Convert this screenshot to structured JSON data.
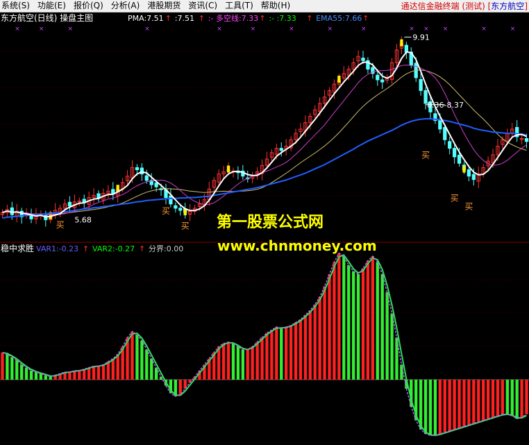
{
  "menu": {
    "items": [
      "系统(S)",
      "功能(E)",
      "报价(Q)",
      "分析(A)",
      "港股期货",
      "资讯(C)",
      "工具(T)",
      "帮助(H)"
    ],
    "title_prefix": "通达信金融终端 (测试) [",
    "title_stock": "东方航空",
    "title_suffix": "]"
  },
  "main_pane": {
    "title": "东方航空(日线) 操盘主图",
    "indicators": [
      {
        "label": "PMA:7.51",
        "color": "#ffffff",
        "arrow": "↑"
      },
      {
        "label": ":7.51",
        "color": "#ffffff",
        "arrow": "↑"
      },
      {
        "label": ":- 多空线:7.33",
        "color": "#ff44ff",
        "arrow": "↑"
      },
      {
        "label": ":- :7.33",
        "color": "#00ff00",
        "arrow": "↑"
      },
      {
        "label": "EMA55:7.66",
        "color": "#4a8cff",
        "arrow": "↑"
      }
    ],
    "annotations": {
      "high_label": "9.91",
      "range_label": "8.36-8.37",
      "low_label": "5.68",
      "buy_label": "买"
    }
  },
  "sub_pane": {
    "title": "稳中求胜",
    "indicators": [
      {
        "label": "VAR1:-0.23",
        "color": "#6060ff",
        "arrow": "↑"
      },
      {
        "label": "VAR2:-0.27",
        "color": "#00ff00",
        "arrow": "↑"
      },
      {
        "label": "分界:0.00",
        "color": "#cccccc",
        "arrow": ""
      }
    ]
  },
  "watermark": {
    "line1": "第一股票公式网",
    "line2": "www.chnmoney.com"
  },
  "colors": {
    "up": "#ff3232",
    "down": "#54ffff",
    "bar_red": "#ff2020",
    "bar_green": "#33ee33",
    "ma_white": "#ffffff",
    "ma_magenta": "#d040d0",
    "ma_yellow": "#d0c070",
    "ema_blue": "#2060ff",
    "var1": "#c060ff",
    "var2": "#30dd60",
    "divider": "#800000"
  },
  "chart_data": {
    "type": "candlestick",
    "price_range": [
      5.3,
      10.2
    ],
    "osc_range": [
      -0.42,
      0.88
    ],
    "close": [
      5.85,
      5.92,
      5.8,
      5.88,
      5.75,
      5.84,
      5.7,
      5.78,
      5.82,
      5.68,
      5.76,
      5.9,
      5.95,
      6.05,
      6.0,
      6.1,
      6.12,
      6.08,
      6.2,
      6.25,
      6.18,
      6.3,
      6.35,
      6.28,
      6.4,
      6.55,
      6.7,
      6.9,
      6.85,
      6.75,
      6.6,
      6.5,
      6.45,
      6.38,
      6.2,
      6.05,
      5.95,
      5.9,
      5.85,
      5.88,
      5.95,
      6.05,
      6.15,
      6.4,
      6.6,
      6.75,
      6.8,
      6.85,
      6.82,
      6.78,
      6.7,
      6.65,
      6.72,
      6.8,
      6.95,
      7.1,
      7.25,
      7.35,
      7.3,
      7.4,
      7.55,
      7.7,
      7.8,
      7.95,
      8.1,
      8.25,
      8.4,
      8.55,
      8.7,
      8.85,
      8.95,
      9.1,
      9.2,
      9.35,
      9.5,
      9.4,
      9.2,
      9.1,
      8.95,
      8.9,
      9.0,
      9.35,
      9.65,
      9.8,
      9.6,
      9.3,
      9.0,
      8.7,
      8.4,
      8.2,
      8.0,
      7.8,
      7.55,
      7.35,
      7.15,
      7.0,
      6.85,
      6.7,
      6.62,
      6.75,
      6.9,
      7.05,
      7.2,
      7.4,
      7.55,
      7.7,
      7.8,
      7.62,
      7.58,
      7.51
    ],
    "ema55": [
      5.72,
      5.74,
      5.75,
      5.76,
      5.77,
      5.78,
      5.79,
      5.8,
      5.81,
      5.82,
      5.83,
      5.84,
      5.85,
      5.87,
      5.88,
      5.9,
      5.91,
      5.93,
      5.94,
      5.96,
      5.97,
      5.99,
      6.0,
      6.02,
      6.03,
      6.05,
      6.06,
      6.08,
      6.1,
      6.11,
      6.13,
      6.14,
      6.15,
      6.16,
      6.17,
      6.18,
      6.18,
      6.19,
      6.19,
      6.2,
      6.2,
      6.21,
      6.22,
      6.23,
      6.25,
      6.27,
      6.29,
      6.31,
      6.33,
      6.35,
      6.37,
      6.39,
      6.41,
      6.43,
      6.46,
      6.49,
      6.52,
      6.55,
      6.58,
      6.61,
      6.65,
      6.69,
      6.73,
      6.77,
      6.82,
      6.87,
      6.92,
      6.97,
      7.03,
      7.09,
      7.15,
      7.21,
      7.27,
      7.33,
      7.4,
      7.46,
      7.52,
      7.57,
      7.62,
      7.67,
      7.72,
      7.77,
      7.83,
      7.89,
      7.94,
      7.98,
      8.01,
      8.03,
      8.04,
      8.04,
      8.03,
      8.02,
      8.0,
      7.98,
      7.95,
      7.92,
      7.89,
      7.86,
      7.82,
      7.79,
      7.77,
      7.75,
      7.73,
      7.72,
      7.71,
      7.7,
      7.7,
      7.69,
      7.68,
      7.66
    ],
    "osc": [
      0.18,
      0.17,
      0.15,
      0.13,
      0.1,
      0.08,
      0.06,
      0.05,
      0.04,
      0.03,
      0.02,
      0.03,
      0.04,
      0.05,
      0.05,
      0.06,
      0.06,
      0.07,
      0.08,
      0.09,
      0.09,
      0.1,
      0.12,
      0.14,
      0.17,
      0.22,
      0.28,
      0.32,
      0.3,
      0.26,
      0.2,
      0.14,
      0.08,
      0.02,
      -0.04,
      -0.09,
      -0.11,
      -0.1,
      -0.06,
      -0.02,
      0.02,
      0.06,
      0.1,
      0.14,
      0.18,
      0.22,
      0.24,
      0.25,
      0.24,
      0.22,
      0.2,
      0.2,
      0.22,
      0.25,
      0.28,
      0.31,
      0.33,
      0.35,
      0.34,
      0.35,
      0.36,
      0.38,
      0.4,
      0.43,
      0.46,
      0.5,
      0.55,
      0.62,
      0.7,
      0.78,
      0.84,
      0.82,
      0.76,
      0.72,
      0.7,
      0.74,
      0.79,
      0.82,
      0.78,
      0.7,
      0.58,
      0.44,
      0.28,
      0.1,
      -0.06,
      -0.18,
      -0.27,
      -0.33,
      -0.36,
      -0.37,
      -0.37,
      -0.36,
      -0.35,
      -0.34,
      -0.33,
      -0.32,
      -0.31,
      -0.3,
      -0.29,
      -0.28,
      -0.27,
      -0.26,
      -0.25,
      -0.24,
      -0.23,
      -0.23,
      -0.24,
      -0.26,
      -0.25,
      -0.23
    ]
  }
}
